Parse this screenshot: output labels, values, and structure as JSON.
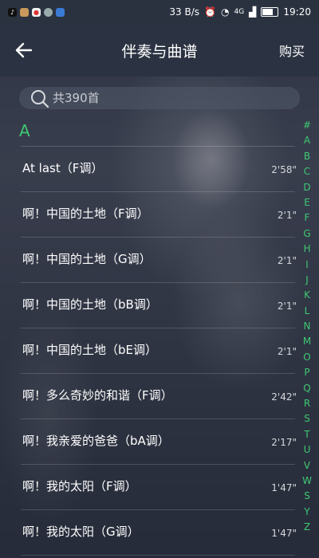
{
  "status": {
    "speed": "33 B/s",
    "time": "19:20",
    "signal": "4G"
  },
  "header": {
    "title": "伴奏与曲谱",
    "buy_label": "购买"
  },
  "search": {
    "placeholder": "共390首"
  },
  "section": {
    "letter": "A"
  },
  "songs": [
    {
      "title": "At last（F调）",
      "duration": "2'58\""
    },
    {
      "title": "啊！中国的土地（F调）",
      "duration": "2'1\""
    },
    {
      "title": "啊！中国的土地（G调）",
      "duration": "2'1\""
    },
    {
      "title": "啊！中国的土地（bB调）",
      "duration": "2'1\""
    },
    {
      "title": "啊！中国的土地（bE调）",
      "duration": "2'1\""
    },
    {
      "title": "啊！多么奇妙的和谐（F调）",
      "duration": "2'42\""
    },
    {
      "title": "啊！我亲爱的爸爸（bA调）",
      "duration": "2'17\""
    },
    {
      "title": "啊！我的太阳（F调）",
      "duration": "1'47\""
    },
    {
      "title": "啊！我的太阳（G调）",
      "duration": "1'47\""
    }
  ],
  "index_letters": [
    "#",
    "A",
    "B",
    "C",
    "D",
    "E",
    "F",
    "G",
    "H",
    "I",
    "J",
    "K",
    "L",
    "N",
    "M",
    "O",
    "P",
    "Q",
    "R",
    "S",
    "T",
    "U",
    "V",
    "W",
    "S",
    "Y",
    "Z"
  ],
  "colors": {
    "accent": "#3ec872",
    "navbar": "#2b3342"
  }
}
